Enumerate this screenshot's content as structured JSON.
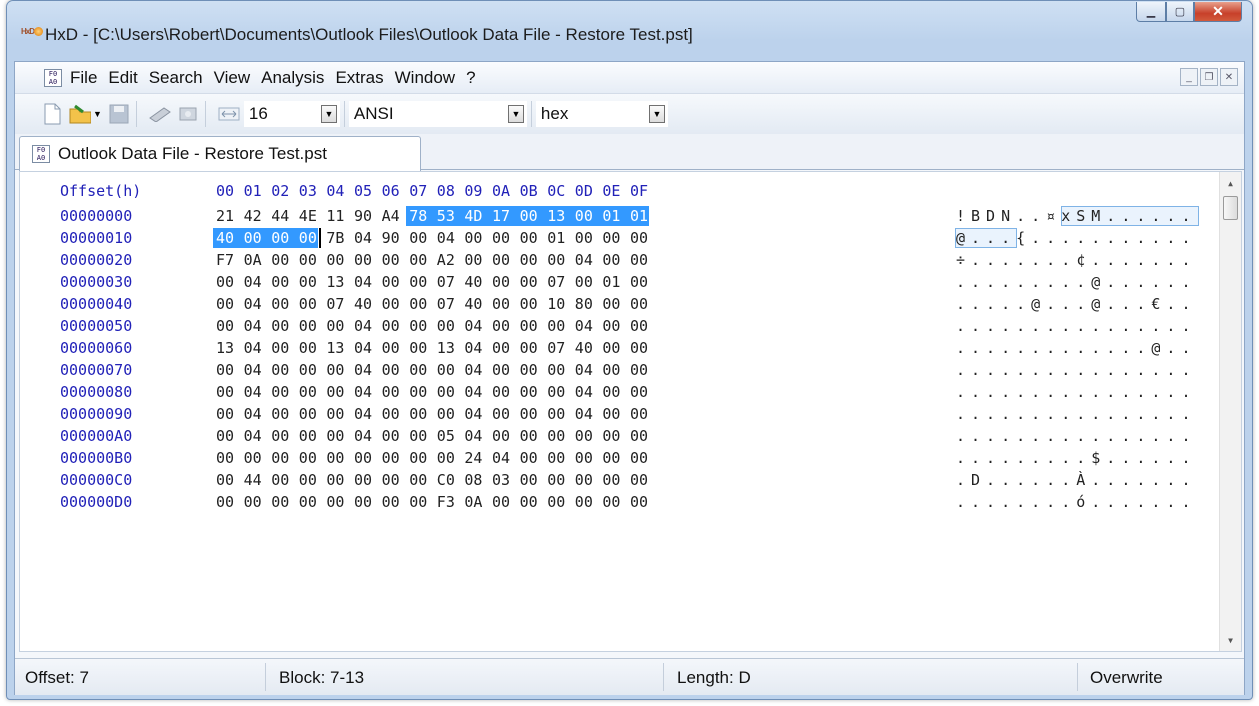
{
  "window": {
    "title": "HxD - [C:\\Users\\Robert\\Documents\\Outlook Files\\Outlook Data File - Restore Test.pst]",
    "app_icon_text": "HxD"
  },
  "menubar": {
    "items": [
      "File",
      "Edit",
      "Search",
      "View",
      "Analysis",
      "Extras",
      "Window",
      "?"
    ]
  },
  "toolbar": {
    "bytes_per_row": "16",
    "charset": "ANSI",
    "offset_base": "hex",
    "icons": [
      "new-file-icon",
      "open-file-icon",
      "save-icon",
      "ram-icon",
      "disk-icon",
      "bytes-per-row-icon"
    ]
  },
  "tab": {
    "label": "Outlook Data File - Restore Test.pst"
  },
  "hex": {
    "offset_header": "Offset(h)",
    "columns": [
      "00",
      "01",
      "02",
      "03",
      "04",
      "05",
      "06",
      "07",
      "08",
      "09",
      "0A",
      "0B",
      "0C",
      "0D",
      "0E",
      "0F"
    ],
    "rows": [
      {
        "offset": "00000000",
        "bytes": [
          "21",
          "42",
          "44",
          "4E",
          "11",
          "90",
          "A4",
          "78",
          "53",
          "4D",
          "17",
          "00",
          "13",
          "00",
          "01",
          "01"
        ],
        "ascii": "!BDN..¤xSM......"
      },
      {
        "offset": "00000010",
        "bytes": [
          "40",
          "00",
          "00",
          "00",
          "7B",
          "04",
          "90",
          "00",
          "04",
          "00",
          "00",
          "00",
          "01",
          "00",
          "00",
          "00"
        ],
        "ascii": "@...{..........."
      },
      {
        "offset": "00000020",
        "bytes": [
          "F7",
          "0A",
          "00",
          "00",
          "00",
          "00",
          "00",
          "00",
          "A2",
          "00",
          "00",
          "00",
          "00",
          "04",
          "00",
          "00"
        ],
        "ascii": "÷.......¢......."
      },
      {
        "offset": "00000030",
        "bytes": [
          "00",
          "04",
          "00",
          "00",
          "13",
          "04",
          "00",
          "00",
          "07",
          "40",
          "00",
          "00",
          "07",
          "00",
          "01",
          "00"
        ],
        "ascii": ".........@......"
      },
      {
        "offset": "00000040",
        "bytes": [
          "00",
          "04",
          "00",
          "00",
          "07",
          "40",
          "00",
          "00",
          "07",
          "40",
          "00",
          "00",
          "10",
          "80",
          "00",
          "00"
        ],
        "ascii": ".....@...@...€.."
      },
      {
        "offset": "00000050",
        "bytes": [
          "00",
          "04",
          "00",
          "00",
          "00",
          "04",
          "00",
          "00",
          "00",
          "04",
          "00",
          "00",
          "00",
          "04",
          "00",
          "00"
        ],
        "ascii": "................"
      },
      {
        "offset": "00000060",
        "bytes": [
          "13",
          "04",
          "00",
          "00",
          "13",
          "04",
          "00",
          "00",
          "13",
          "04",
          "00",
          "00",
          "07",
          "40",
          "00",
          "00"
        ],
        "ascii": ".............@.."
      },
      {
        "offset": "00000070",
        "bytes": [
          "00",
          "04",
          "00",
          "00",
          "00",
          "04",
          "00",
          "00",
          "00",
          "04",
          "00",
          "00",
          "00",
          "04",
          "00",
          "00"
        ],
        "ascii": "................"
      },
      {
        "offset": "00000080",
        "bytes": [
          "00",
          "04",
          "00",
          "00",
          "00",
          "04",
          "00",
          "00",
          "00",
          "04",
          "00",
          "00",
          "00",
          "04",
          "00",
          "00"
        ],
        "ascii": "................"
      },
      {
        "offset": "00000090",
        "bytes": [
          "00",
          "04",
          "00",
          "00",
          "00",
          "04",
          "00",
          "00",
          "00",
          "04",
          "00",
          "00",
          "00",
          "04",
          "00",
          "00"
        ],
        "ascii": "................"
      },
      {
        "offset": "000000A0",
        "bytes": [
          "00",
          "04",
          "00",
          "00",
          "00",
          "04",
          "00",
          "00",
          "05",
          "04",
          "00",
          "00",
          "00",
          "00",
          "00",
          "00"
        ],
        "ascii": "................"
      },
      {
        "offset": "000000B0",
        "bytes": [
          "00",
          "00",
          "00",
          "00",
          "00",
          "00",
          "00",
          "00",
          "00",
          "24",
          "04",
          "00",
          "00",
          "00",
          "00",
          "00"
        ],
        "ascii": ".........$......"
      },
      {
        "offset": "000000C0",
        "bytes": [
          "00",
          "44",
          "00",
          "00",
          "00",
          "00",
          "00",
          "00",
          "C0",
          "08",
          "03",
          "00",
          "00",
          "00",
          "00",
          "00"
        ],
        "ascii": ".D......À......."
      },
      {
        "offset": "000000D0",
        "bytes": [
          "00",
          "00",
          "00",
          "00",
          "00",
          "00",
          "00",
          "00",
          "F3",
          "0A",
          "00",
          "00",
          "00",
          "00",
          "00",
          "00"
        ],
        "ascii": "........ó......."
      }
    ]
  },
  "status": {
    "offset": "Offset: 7",
    "block": "Block: 7-13",
    "length": "Length: D",
    "mode": "Overwrite"
  }
}
